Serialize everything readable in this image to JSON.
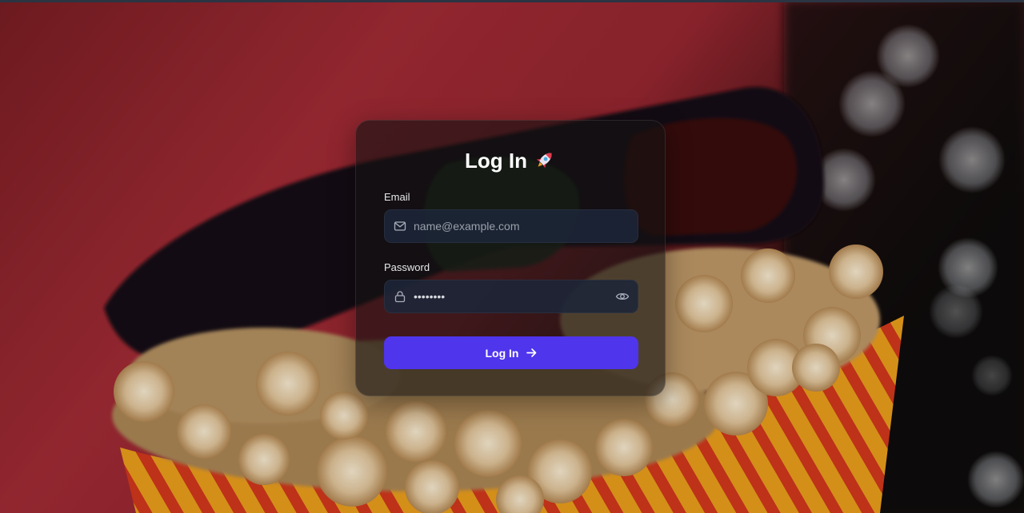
{
  "login": {
    "title": "Log In",
    "title_emoji_icon": "rocket-icon",
    "email": {
      "label": "Email",
      "placeholder": "name@example.com",
      "value": "",
      "icon": "mail-icon"
    },
    "password": {
      "label": "Password",
      "value": "password",
      "icon": "lock-icon",
      "toggle_icon": "eye-icon"
    },
    "submit": {
      "label": "Log In",
      "icon": "arrow-right-icon"
    }
  },
  "colors": {
    "button": "#4f35ec",
    "card": "#141212",
    "input": "#1c2638",
    "text": "#ffffff"
  }
}
